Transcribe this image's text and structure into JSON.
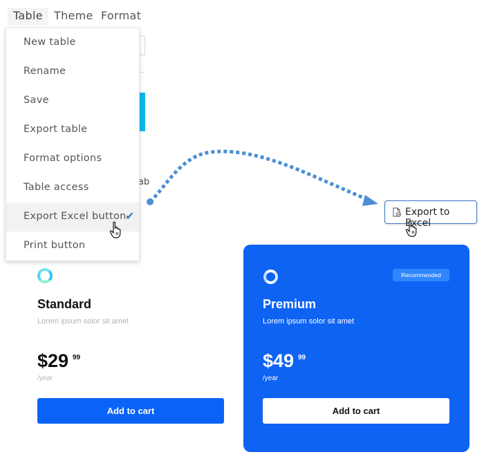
{
  "menubar": {
    "items": [
      {
        "label": "Table"
      },
      {
        "label": "Theme"
      },
      {
        "label": "Format"
      }
    ]
  },
  "dropdown": {
    "items": [
      {
        "label": "New table"
      },
      {
        "label": "Rename"
      },
      {
        "label": "Save"
      },
      {
        "label": "Export table"
      },
      {
        "label": "Format options"
      },
      {
        "label": "Table access"
      },
      {
        "label": "Export Excel button",
        "checked": true
      },
      {
        "label": "Print button"
      }
    ]
  },
  "background": {
    "partial_text": "ab"
  },
  "export_button": {
    "label": "Export to Excel",
    "icon": "export-file-icon"
  },
  "pricing": {
    "standard": {
      "title": "Standard",
      "subtitle": "Lorem ipsum solor sit amet",
      "price": "$29",
      "cents": "99",
      "period": "/year",
      "button": "Add to cart"
    },
    "premium": {
      "badge": "Recommended",
      "title": "Premium",
      "subtitle": "Lorem ipsum solor sit amet",
      "price": "$49",
      "cents": "99",
      "period": "/year",
      "button": "Add to cart"
    }
  },
  "colors": {
    "accent": "#0a63f6",
    "premium_bg": "#0e63f3",
    "arrow": "#4a8fd6",
    "check": "#2a79c8"
  }
}
